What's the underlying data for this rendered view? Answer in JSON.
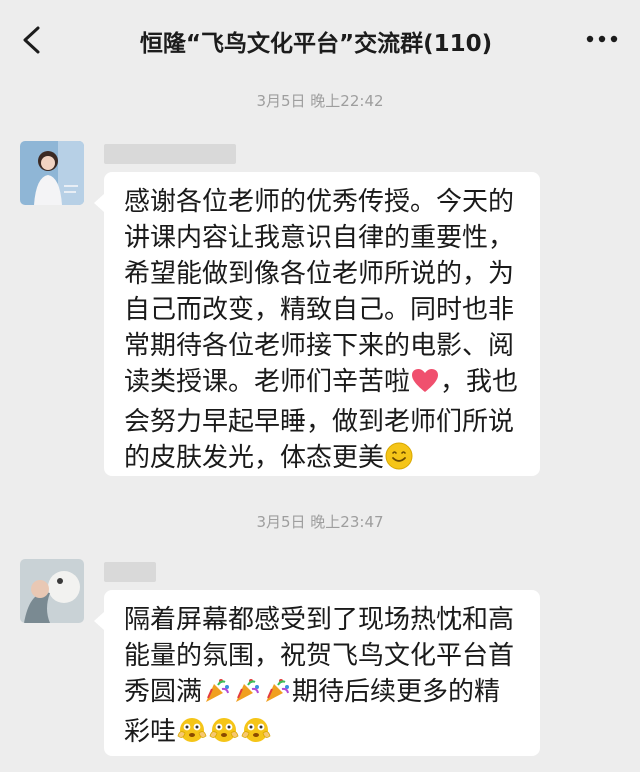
{
  "header": {
    "title": "恒隆“飞鸟文化平台”交流群(110)",
    "back_icon": "chevron-left-icon",
    "more_icon": "more-dots-icon"
  },
  "messages": [
    {
      "timestamp": "3月5日 晚上22:42",
      "lines": [
        "感谢各位老师的优秀传授。今天的",
        "讲课内容让我意识自律的重要性，",
        "希望能做到像各位老师所说的，为",
        "自己而改变，精致自己。同时也非",
        "常期待各位老师接下来的电影、阅",
        "读类授课。老师们辛苦啦",
        "，我也",
        "会努力早起早睡，做到老师们所说",
        "的皮肤发光，体态更美"
      ]
    },
    {
      "timestamp": "3月5日 晚上23:47",
      "lines": [
        "隔着屏幕都感受到了现场热忱和高",
        "能量的氛围，祝贺飞鸟文化平台首",
        "秀圆满",
        "期待后续更多的精",
        "彩哇"
      ]
    }
  ],
  "colors": {
    "background": "#ededed",
    "bubble": "#ffffff",
    "heart": "#f0506e",
    "smiley": "#f5c518"
  }
}
